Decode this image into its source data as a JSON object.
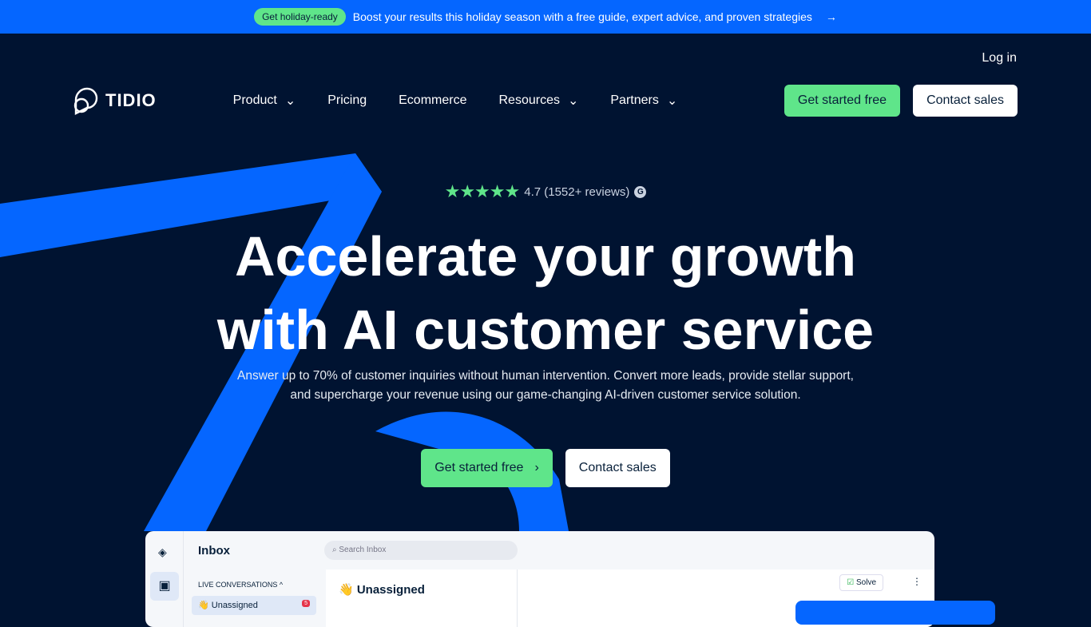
{
  "banner": {
    "pill": "Get holiday-ready",
    "text": "Boost your results this holiday season with a free guide, expert advice, and proven strategies",
    "arrow": "→"
  },
  "header": {
    "login": "Log in",
    "logo": "TIDIO",
    "menu": [
      {
        "label": "Product",
        "dropdown": true
      },
      {
        "label": "Pricing"
      },
      {
        "label": "Ecommerce"
      },
      {
        "label": "Resources",
        "dropdown": true
      },
      {
        "label": "Partners",
        "dropdown": true
      }
    ],
    "get_started": "Get started free",
    "contact": "Contact sales"
  },
  "hero": {
    "stars": "★★★★★",
    "rating": "4.7 (1552+ reviews)",
    "title_line1": "Accelerate your growth",
    "title_line2": "with AI customer service",
    "subtitle": "Answer up to 70% of customer inquiries without human intervention. Convert more leads, provide stellar support, and supercharge your revenue using our game-changing AI-driven customer service solution.",
    "get_started": "Get started free",
    "contact": "Contact sales"
  },
  "app": {
    "title": "Inbox",
    "search_placeholder": "Search Inbox",
    "section": "LIVE CONVERSATIONS ^",
    "item": "👋 Unassigned",
    "badge": "5",
    "panel_title": "👋 Unassigned",
    "solve": "Solve"
  },
  "colors": {
    "background": "#001331",
    "accent": "#0566ff",
    "green": "#5fe58a"
  }
}
